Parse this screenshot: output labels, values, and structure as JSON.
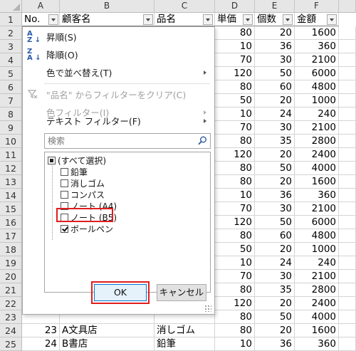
{
  "columns": [
    "A",
    "B",
    "C",
    "D",
    "E",
    "F"
  ],
  "header_row": {
    "row_num": "1",
    "no": "No.",
    "customer": "顧客名",
    "product": "品名",
    "unit_price": "単価",
    "qty": "個数",
    "amount": "金額"
  },
  "rows": [
    {
      "r": "2",
      "d": "80",
      "e": "20",
      "f": "1600"
    },
    {
      "r": "3",
      "d": "10",
      "e": "36",
      "f": "360"
    },
    {
      "r": "4",
      "d": "70",
      "e": "30",
      "f": "2100"
    },
    {
      "r": "5",
      "d": "120",
      "e": "50",
      "f": "6000"
    },
    {
      "r": "6",
      "d": "80",
      "e": "60",
      "f": "4800"
    },
    {
      "r": "7",
      "d": "50",
      "e": "20",
      "f": "1000"
    },
    {
      "r": "8",
      "d": "10",
      "e": "24",
      "f": "240"
    },
    {
      "r": "9",
      "d": "70",
      "e": "30",
      "f": "2100"
    },
    {
      "r": "10",
      "d": "80",
      "e": "35",
      "f": "2800"
    },
    {
      "r": "11",
      "d": "120",
      "e": "20",
      "f": "2400"
    },
    {
      "r": "12",
      "d": "80",
      "e": "50",
      "f": "4000"
    },
    {
      "r": "13",
      "d": "80",
      "e": "20",
      "f": "1600"
    },
    {
      "r": "14",
      "d": "10",
      "e": "36",
      "f": "360"
    },
    {
      "r": "15",
      "d": "70",
      "e": "30",
      "f": "2100"
    },
    {
      "r": "16",
      "d": "120",
      "e": "50",
      "f": "6000"
    },
    {
      "r": "17",
      "d": "80",
      "e": "60",
      "f": "4800"
    },
    {
      "r": "18",
      "d": "50",
      "e": "20",
      "f": "1000"
    },
    {
      "r": "19",
      "d": "10",
      "e": "24",
      "f": "240"
    },
    {
      "r": "20",
      "d": "70",
      "e": "30",
      "f": "2100"
    },
    {
      "r": "21",
      "d": "80",
      "e": "35",
      "f": "2800"
    },
    {
      "r": "22",
      "d": "120",
      "e": "20",
      "f": "2400"
    },
    {
      "r": "23",
      "d": "80",
      "e": "50",
      "f": "4000"
    },
    {
      "r": "24",
      "a": "23",
      "b": "A文具店",
      "c": "消しゴム",
      "d": "80",
      "e": "20",
      "f": "1600"
    },
    {
      "r": "25",
      "a": "24",
      "b": "B書店",
      "c": "鉛筆",
      "d": "10",
      "e": "36",
      "f": "360"
    }
  ],
  "menu": {
    "sort_asc": "昇順(S)",
    "sort_desc": "降順(O)",
    "sort_by_color": "色で並べ替え(T)",
    "clear_filter": "\"品名\" からフィルターをクリア(C)",
    "color_filter": "色フィルター(I)",
    "text_filter": "テキスト フィルター(F)",
    "search_placeholder": "検索",
    "items": [
      {
        "label": "(すべて選択)",
        "state": "mixed"
      },
      {
        "label": "鉛筆",
        "state": "unchecked"
      },
      {
        "label": "消しゴム",
        "state": "unchecked"
      },
      {
        "label": "コンパス",
        "state": "unchecked"
      },
      {
        "label": "ノート (A4)",
        "state": "unchecked"
      },
      {
        "label": "ノート (B5)",
        "state": "unchecked"
      },
      {
        "label": "ボールペン",
        "state": "checked"
      }
    ],
    "ok": "OK",
    "cancel": "キャンセル"
  }
}
